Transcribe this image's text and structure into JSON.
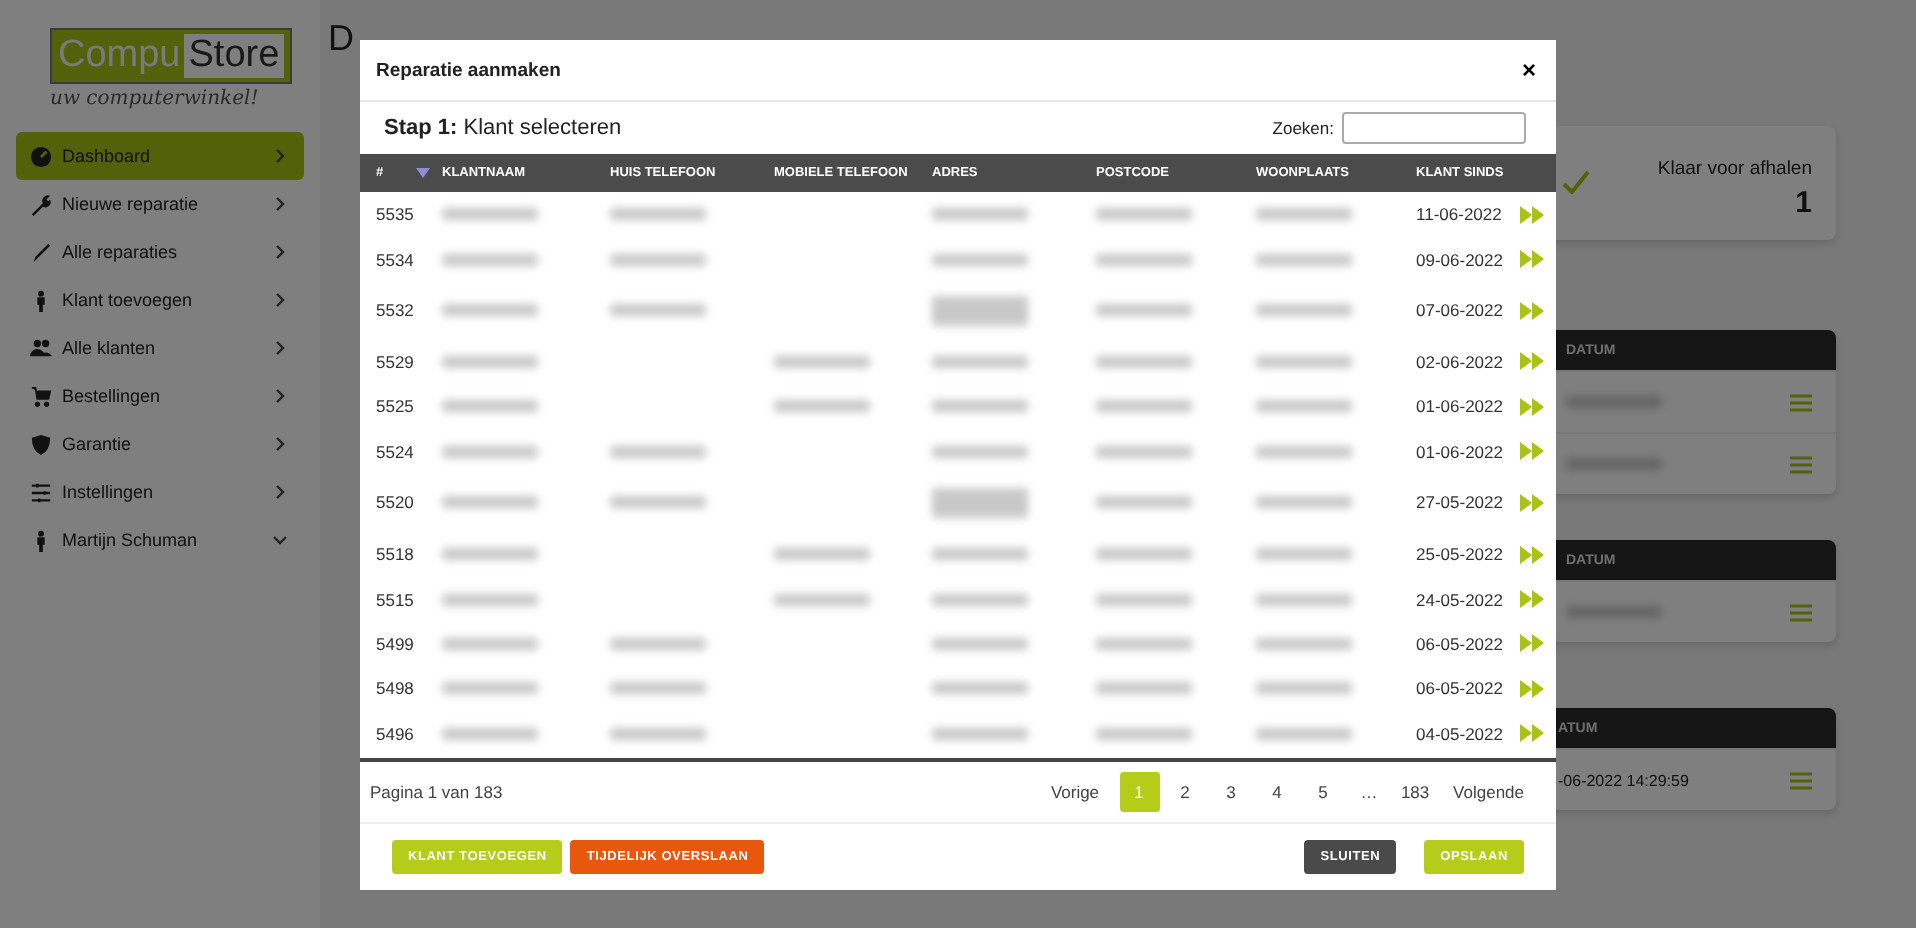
{
  "sidebar": {
    "logo": {
      "left": "Compu",
      "right": "Store",
      "tagline": "uw computerwinkel!"
    },
    "items": [
      {
        "label": "Dashboard",
        "selected": true,
        "expanded": false
      },
      {
        "label": "Nieuwe reparatie",
        "selected": false,
        "expanded": false
      },
      {
        "label": "Alle reparaties",
        "selected": false,
        "expanded": false
      },
      {
        "label": "Klant toevoegen",
        "selected": false,
        "expanded": false
      },
      {
        "label": "Alle klanten",
        "selected": false,
        "expanded": false
      },
      {
        "label": "Bestellingen",
        "selected": false,
        "expanded": false
      },
      {
        "label": "Garantie",
        "selected": false,
        "expanded": false
      },
      {
        "label": "Instellingen",
        "selected": false,
        "expanded": false
      },
      {
        "label": "Martijn Schuman",
        "selected": false,
        "expanded": true
      }
    ]
  },
  "page_title": "D",
  "stat_card": {
    "label": "Klaar voor afhalen",
    "value": "1"
  },
  "side_tables": [
    {
      "header": "DATUM",
      "rows": [
        {
          "kind": "blurred"
        },
        {
          "kind": "blurred"
        }
      ]
    },
    {
      "header": "DATUM",
      "rows": [
        {
          "kind": "blurred"
        }
      ]
    },
    {
      "header": "ATUM",
      "rows": [
        {
          "kind": "date",
          "date": "-06-2022 14:29:59"
        }
      ]
    }
  ],
  "modal": {
    "title": "Reparatie aanmaken",
    "close": "×",
    "step": "**Stap 1:** Klant selecteren",
    "search_label": "Zoeken:",
    "columns": [
      {
        "label": "#"
      },
      {
        "label": "KLANTNAAM"
      },
      {
        "label": "HUIS TELEFOON"
      },
      {
        "label": "MOBIELE TELEFOON"
      },
      {
        "label": "ADRES"
      },
      {
        "label": "POSTCODE"
      },
      {
        "label": "WOONPLAATS"
      },
      {
        "label": "KLANT SINDS"
      }
    ],
    "rows": [
      {
        "number": "5535",
        "since": "11-06-2022",
        "blurred": [
          true,
          true,
          false,
          true,
          true,
          true
        ],
        "tall": false
      },
      {
        "number": "5534",
        "since": "09-06-2022",
        "blurred": [
          true,
          true,
          false,
          true,
          true,
          true
        ],
        "tall": false
      },
      {
        "number": "5532",
        "since": "07-06-2022",
        "blurred": [
          true,
          true,
          false,
          true,
          true,
          true
        ],
        "tall": true
      },
      {
        "number": "5529",
        "since": "02-06-2022",
        "blurred": [
          true,
          false,
          true,
          true,
          true,
          true
        ],
        "tall": false
      },
      {
        "number": "5525",
        "since": "01-06-2022",
        "blurred": [
          true,
          false,
          true,
          true,
          true,
          true
        ],
        "tall": false
      },
      {
        "number": "5524",
        "since": "01-06-2022",
        "blurred": [
          true,
          true,
          false,
          true,
          true,
          true
        ],
        "tall": false
      },
      {
        "number": "5520",
        "since": "27-05-2022",
        "blurred": [
          true,
          true,
          false,
          true,
          true,
          true
        ],
        "tall": true
      },
      {
        "number": "5518",
        "since": "25-05-2022",
        "blurred": [
          true,
          false,
          true,
          true,
          true,
          true
        ],
        "tall": false
      },
      {
        "number": "5515",
        "since": "24-05-2022",
        "blurred": [
          true,
          false,
          true,
          true,
          true,
          true
        ],
        "tall": false
      },
      {
        "number": "5499",
        "since": "06-05-2022",
        "blurred": [
          true,
          true,
          false,
          true,
          true,
          true
        ],
        "tall": false
      },
      {
        "number": "5498",
        "since": "06-05-2022",
        "blurred": [
          true,
          true,
          false,
          true,
          true,
          true
        ],
        "tall": false
      },
      {
        "number": "5496",
        "since": "04-05-2022",
        "blurred": [
          true,
          true,
          false,
          true,
          true,
          true
        ],
        "tall": false
      }
    ],
    "page_info": "Pagina 1 van 183",
    "pagination": {
      "previous": "Vorige",
      "next": "Volgende",
      "pages": [
        {
          "label": "1",
          "selected": true
        },
        {
          "label": "2",
          "selected": false
        },
        {
          "label": "3",
          "selected": false
        },
        {
          "label": "4",
          "selected": false
        },
        {
          "label": "5",
          "selected": false
        },
        {
          "label": "…",
          "selected": false
        },
        {
          "label": "183",
          "selected": false
        }
      ]
    },
    "buttons_left": [
      {
        "label": "KLANT TOEVOEGEN",
        "kind": "primary"
      },
      {
        "label": "TIJDELIJK OVERSLAAN",
        "kind": "warning"
      }
    ],
    "buttons_right": [
      {
        "label": "SLUITEN",
        "kind": "dark"
      },
      {
        "label": "OPSLAAN",
        "kind": "primary"
      }
    ]
  }
}
